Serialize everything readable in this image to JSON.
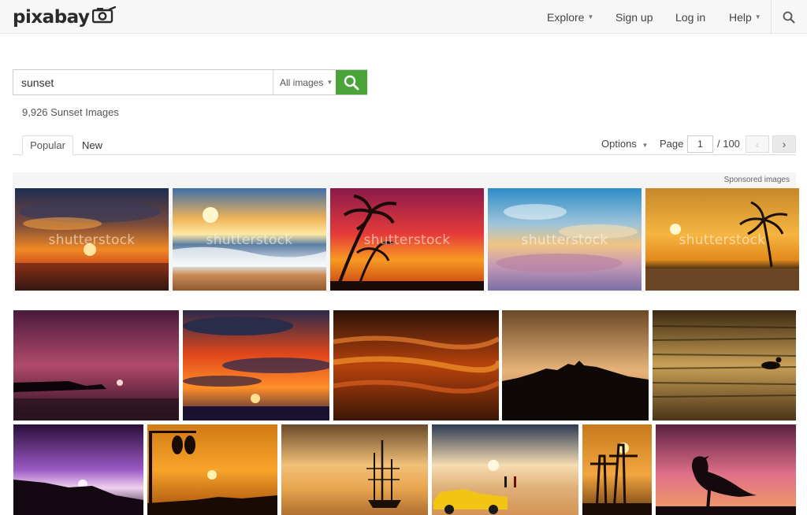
{
  "header": {
    "logo": "pixabay",
    "nav": {
      "explore": "Explore",
      "signup": "Sign up",
      "login": "Log in",
      "help": "Help"
    }
  },
  "search": {
    "query": "sunset",
    "type_label": "All images"
  },
  "results": {
    "count_text": "9,926 Sunset Images"
  },
  "tabs": {
    "popular": "Popular",
    "new": "New"
  },
  "pagination": {
    "options_label": "Options",
    "page_label": "Page",
    "current": "1",
    "total": "/ 100"
  },
  "sponsored": {
    "label": "Sponsored images",
    "watermark": "shutterstock"
  },
  "icons": [
    "camera-icon",
    "search-icon",
    "chevron-left-icon",
    "chevron-right-icon",
    "caret-down-icon"
  ],
  "colors": {
    "accent_green": "#4aa43a",
    "header_bg": "#f7f7f7"
  }
}
